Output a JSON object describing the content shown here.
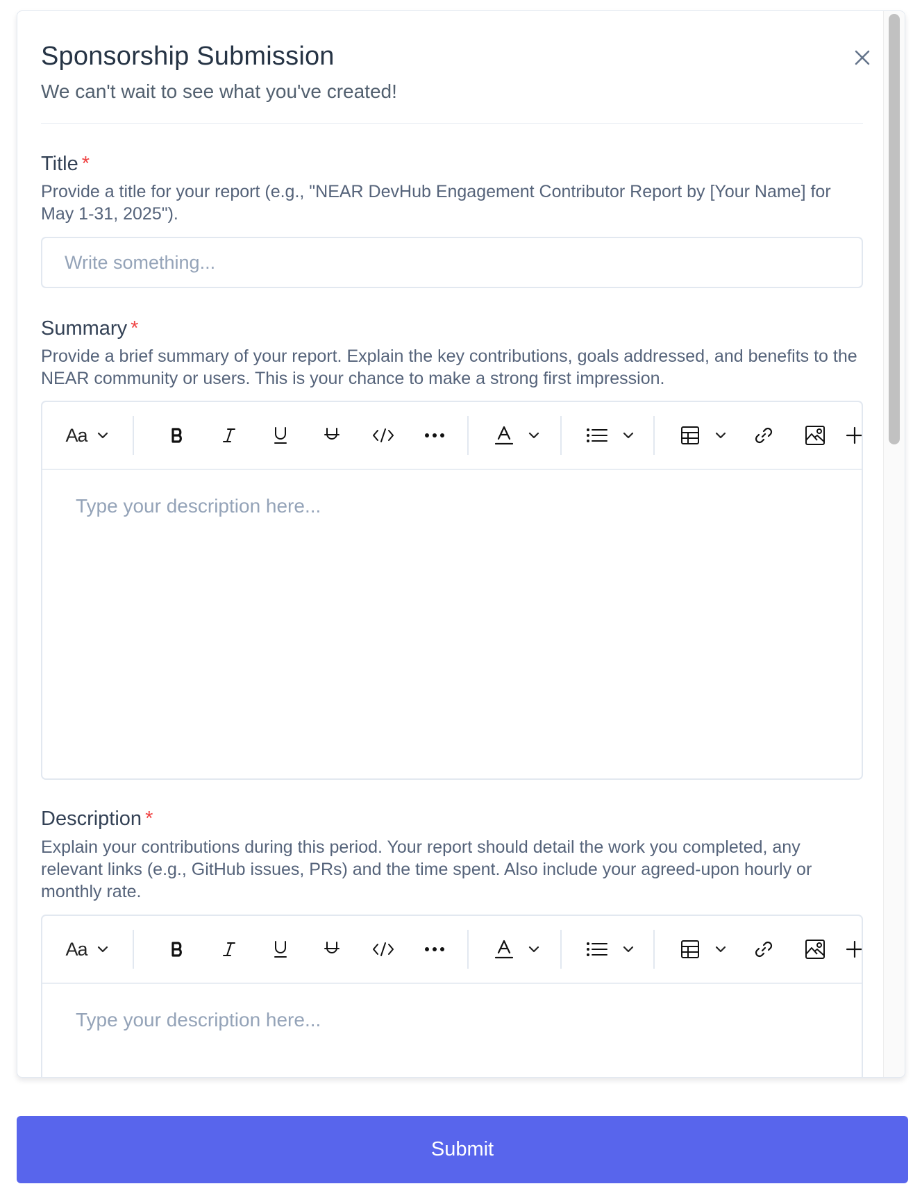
{
  "modal": {
    "title": "Sponsorship Submission",
    "subtitle": "We can't wait to see what you've created!"
  },
  "fields": {
    "title": {
      "label": "Title",
      "required_mark": "*",
      "help": "Provide a title for your report (e.g., \"NEAR DevHub Engagement Contributor Report by [Your Name] for May 1-31, 2025\").",
      "placeholder": "Write something..."
    },
    "summary": {
      "label": "Summary",
      "required_mark": "*",
      "help": "Provide a brief summary of your report. Explain the key contributions, goals addressed, and benefits to the NEAR community or users. This is your chance to make a strong first impression.",
      "placeholder": "Type your description here..."
    },
    "description": {
      "label": "Description",
      "required_mark": "*",
      "help": "Explain your contributions during this period. Your report should detail the work you completed, any relevant links (e.g., GitHub issues, PRs) and the time spent. Also include your agreed-upon hourly or monthly rate.",
      "placeholder": "Type your description here..."
    }
  },
  "toolbar": {
    "text_style_label": "Aa",
    "icons": [
      "chevron-down-icon",
      "bold-icon",
      "italic-icon",
      "underline-icon",
      "strikethrough-icon",
      "code-icon",
      "more-icon",
      "text-color-icon",
      "bullet-list-icon",
      "table-icon",
      "link-icon",
      "image-icon",
      "plus-icon"
    ]
  },
  "submit_label": "Submit",
  "colors": {
    "accent": "#5865ec",
    "required": "#ef4444",
    "heading": "#263445",
    "placeholder": "#94a3b8"
  }
}
